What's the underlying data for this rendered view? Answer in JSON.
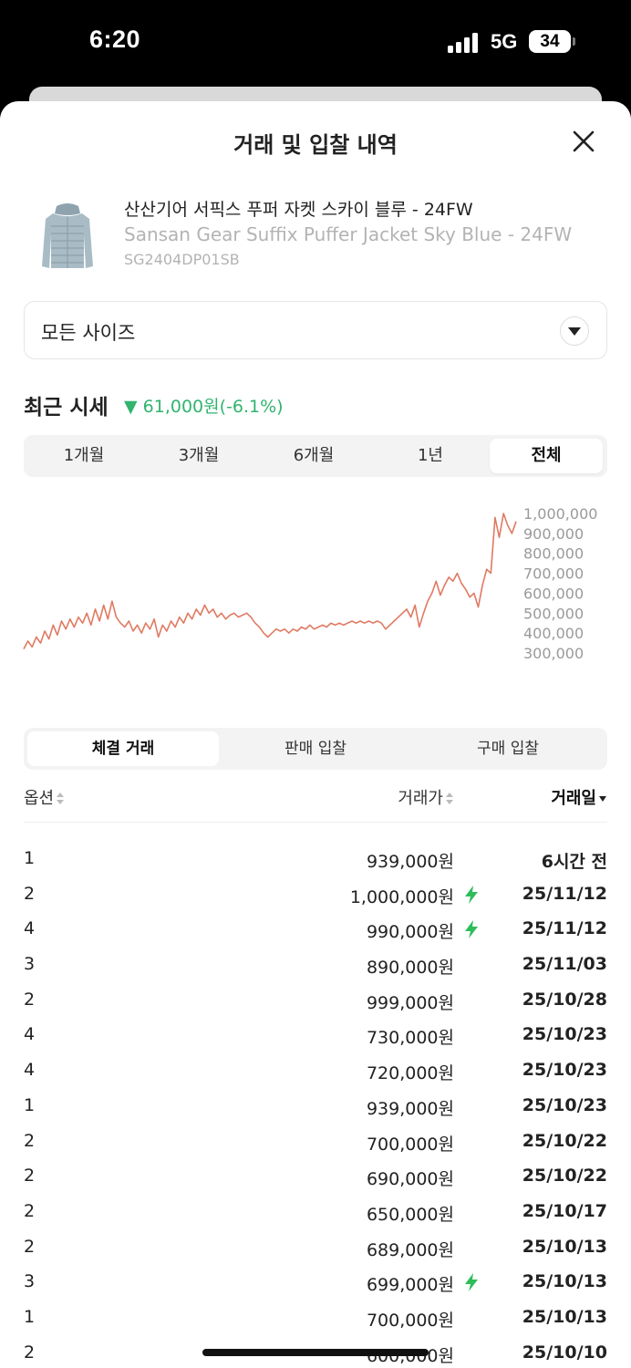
{
  "status": {
    "time": "6:20",
    "network": "5G",
    "battery": "34"
  },
  "sheet": {
    "title": "거래 및 입찰 내역"
  },
  "product": {
    "name_ko": "산산기어 서픽스 푸퍼 자켓 스카이 블루 - 24FW",
    "name_en": "Sansan Gear Suffix Puffer Jacket Sky Blue - 24FW",
    "code": "SG2404DP01SB"
  },
  "size_select": {
    "label": "모든 사이즈"
  },
  "recent": {
    "title": "최근 시세",
    "change": "▼ 61,000원(-6.1%)"
  },
  "period_tabs": [
    {
      "label": "1개월"
    },
    {
      "label": "3개월"
    },
    {
      "label": "6개월"
    },
    {
      "label": "1년"
    },
    {
      "label": "전체"
    }
  ],
  "chart_data": {
    "type": "line",
    "series": [
      {
        "values": [
          320000,
          360000,
          330000,
          380000,
          350000,
          410000,
          370000,
          440000,
          390000,
          460000,
          420000,
          470000,
          430000,
          480000,
          450000,
          500000,
          440000,
          520000,
          460000,
          540000,
          470000,
          560000,
          480000,
          450000,
          430000,
          460000,
          410000,
          440000,
          400000,
          450000,
          420000,
          470000,
          380000,
          440000,
          410000,
          460000,
          430000,
          480000,
          450000,
          500000,
          470000,
          520000,
          490000,
          540000,
          500000,
          520000,
          480000,
          500000,
          470000,
          490000,
          500000,
          480000,
          490000,
          500000,
          480000,
          450000,
          430000,
          400000,
          380000,
          400000,
          420000,
          410000,
          420000,
          400000,
          420000,
          410000,
          430000,
          420000,
          440000,
          420000,
          430000,
          440000,
          430000,
          450000,
          440000,
          450000,
          440000,
          450000,
          460000,
          450000,
          460000,
          450000,
          460000,
          450000,
          460000,
          450000,
          420000,
          440000,
          460000,
          480000,
          500000,
          520000,
          480000,
          540000,
          430000,
          500000,
          560000,
          600000,
          660000,
          590000,
          640000,
          680000,
          660000,
          700000,
          650000,
          620000,
          580000,
          600000,
          530000,
          640000,
          720000,
          700000,
          980000,
          880000,
          1000000,
          940000,
          900000,
          960000
        ]
      }
    ],
    "y_ticks": [
      "1,000,000",
      "900,000",
      "800,000",
      "700,000",
      "600,000",
      "500,000",
      "400,000",
      "300,000"
    ],
    "ylim": [
      300000,
      1000000
    ],
    "colors": {
      "line": "#e07a62",
      "tick": "#9a9a9a"
    }
  },
  "trade_tabs": [
    {
      "label": "체결 거래"
    },
    {
      "label": "판매 입찰"
    },
    {
      "label": "구매 입찰"
    }
  ],
  "columns": {
    "option": "옵션",
    "price": "거래가",
    "date": "거래일"
  },
  "trades": [
    {
      "option": "1",
      "price": "939,000원",
      "fast": false,
      "date": "6시간 전"
    },
    {
      "option": "2",
      "price": "1,000,000원",
      "fast": true,
      "date": "25/11/12"
    },
    {
      "option": "4",
      "price": "990,000원",
      "fast": true,
      "date": "25/11/12"
    },
    {
      "option": "3",
      "price": "890,000원",
      "fast": false,
      "date": "25/11/03"
    },
    {
      "option": "2",
      "price": "999,000원",
      "fast": false,
      "date": "25/10/28"
    },
    {
      "option": "4",
      "price": "730,000원",
      "fast": false,
      "date": "25/10/23"
    },
    {
      "option": "4",
      "price": "720,000원",
      "fast": false,
      "date": "25/10/23"
    },
    {
      "option": "1",
      "price": "939,000원",
      "fast": false,
      "date": "25/10/23"
    },
    {
      "option": "2",
      "price": "700,000원",
      "fast": false,
      "date": "25/10/22"
    },
    {
      "option": "2",
      "price": "690,000원",
      "fast": false,
      "date": "25/10/22"
    },
    {
      "option": "2",
      "price": "650,000원",
      "fast": false,
      "date": "25/10/17"
    },
    {
      "option": "2",
      "price": "689,000원",
      "fast": false,
      "date": "25/10/13"
    },
    {
      "option": "3",
      "price": "699,000원",
      "fast": true,
      "date": "25/10/13"
    },
    {
      "option": "1",
      "price": "700,000원",
      "fast": false,
      "date": "25/10/13"
    },
    {
      "option": "2",
      "price": "600,000원",
      "fast": false,
      "date": "25/10/10"
    }
  ],
  "icons": {
    "close": "close-icon",
    "dropdown": "chevron-down-icon",
    "fast": "lightning-icon",
    "sort": "sort-icon"
  },
  "colors": {
    "accent_green": "#31b46e",
    "bolt_green": "#2ebd59"
  }
}
